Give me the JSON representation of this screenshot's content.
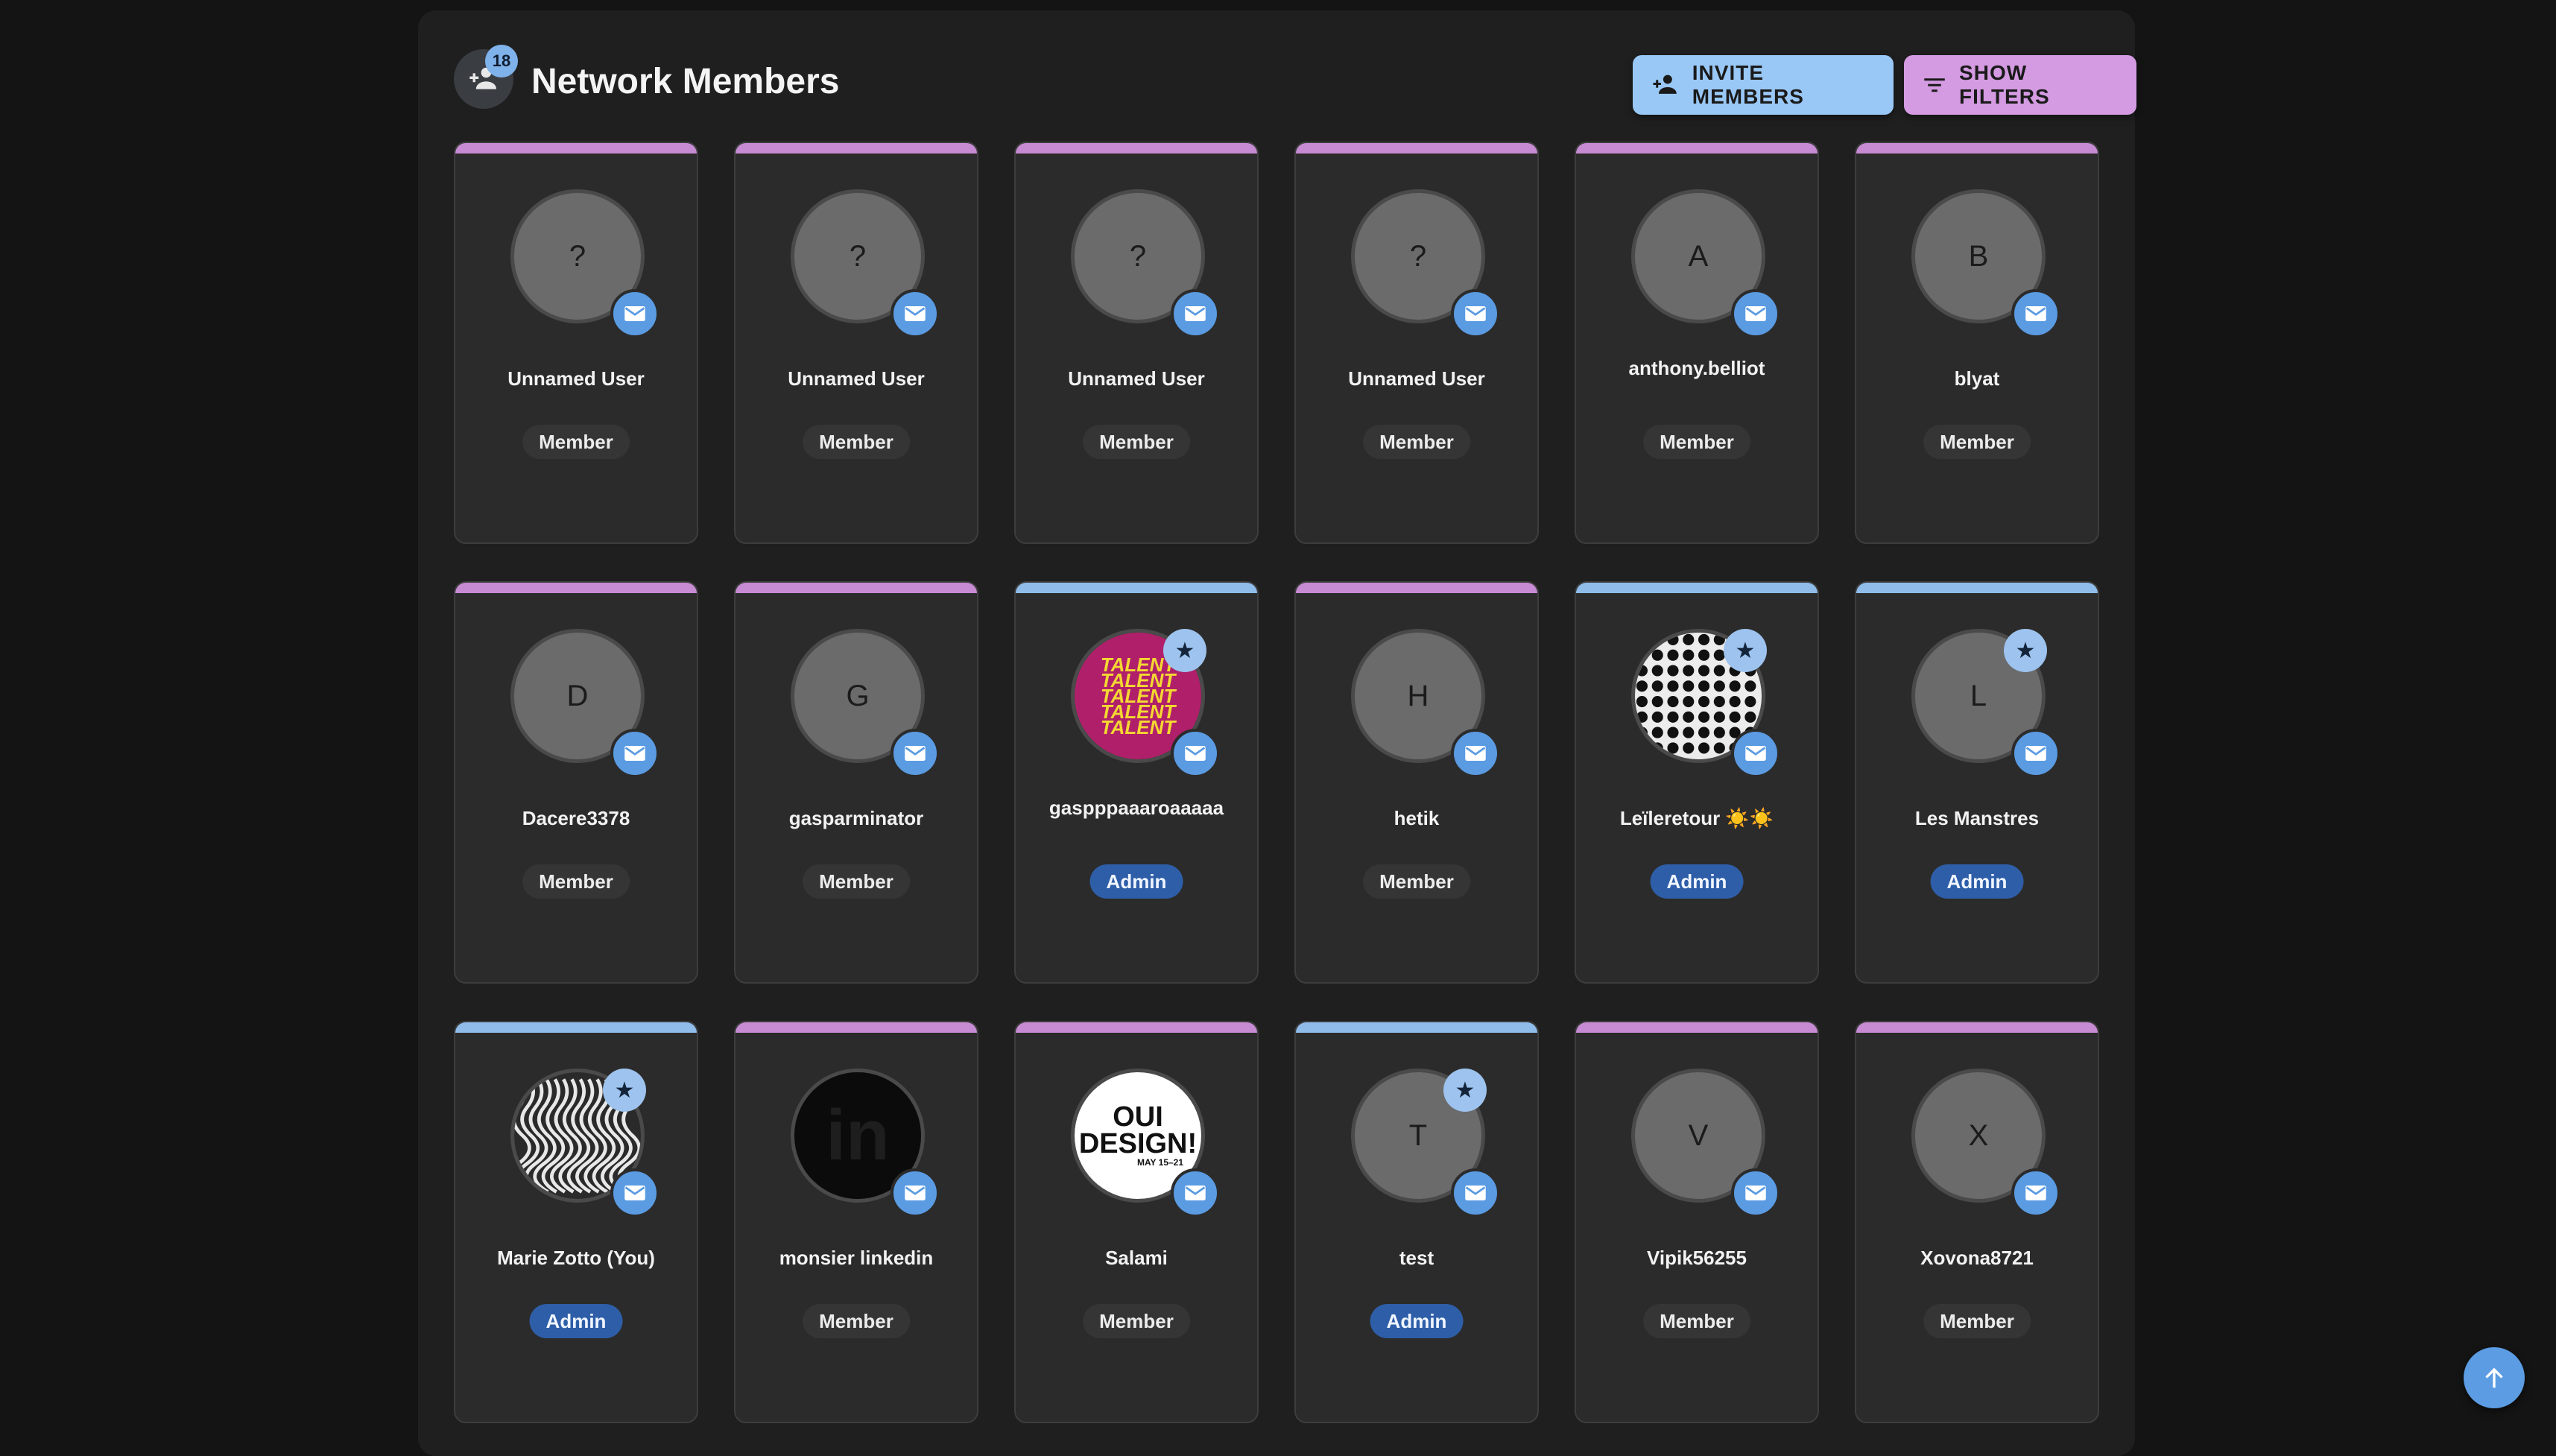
{
  "header": {
    "title": "Network Members",
    "member_count": "18",
    "invite_label": "INVITE MEMBERS",
    "filter_label": "SHOW FILTERS"
  },
  "colors": {
    "member_bar": "#c68bd3",
    "admin_bar": "#8fbce9"
  },
  "members": [
    {
      "name": "Unnamed User",
      "role": "Member",
      "initial": "?",
      "image": null,
      "starred": false
    },
    {
      "name": "Unnamed User",
      "role": "Member",
      "initial": "?",
      "image": null,
      "starred": false
    },
    {
      "name": "Unnamed User",
      "role": "Member",
      "initial": "?",
      "image": null,
      "starred": false
    },
    {
      "name": "Unnamed User",
      "role": "Member",
      "initial": "?",
      "image": null,
      "starred": false
    },
    {
      "name": "anthony.belliot",
      "role": "Member",
      "initial": "A",
      "image": null,
      "starred": false
    },
    {
      "name": "blyat",
      "role": "Member",
      "initial": "B",
      "image": null,
      "starred": false
    },
    {
      "name": "Dacere3378",
      "role": "Member",
      "initial": "D",
      "image": null,
      "starred": false
    },
    {
      "name": "gasparminator",
      "role": "Member",
      "initial": "G",
      "image": null,
      "starred": false
    },
    {
      "name": "gaspppaaaroaaaaa",
      "role": "Admin",
      "initial": "",
      "image": "talent",
      "starred": true
    },
    {
      "name": "hetik",
      "role": "Member",
      "initial": "H",
      "image": null,
      "starred": false
    },
    {
      "name": "Leïleretour ☀️☀️",
      "role": "Admin",
      "initial": "",
      "image": "pattern",
      "starred": true
    },
    {
      "name": "Les Manstres",
      "role": "Admin",
      "initial": "L",
      "image": null,
      "starred": true
    },
    {
      "name": "Marie Zotto (You)",
      "role": "Admin",
      "initial": "",
      "image": "maze",
      "starred": true
    },
    {
      "name": "monsier linkedin",
      "role": "Member",
      "initial": "",
      "image": "linkedin",
      "starred": false
    },
    {
      "name": "Salami",
      "role": "Member",
      "initial": "",
      "image": "ouidesign",
      "starred": false
    },
    {
      "name": "test",
      "role": "Admin",
      "initial": "T",
      "image": null,
      "starred": true
    },
    {
      "name": "Vipik56255",
      "role": "Member",
      "initial": "V",
      "image": null,
      "starred": false
    },
    {
      "name": "Xovona8721",
      "role": "Member",
      "initial": "X",
      "image": null,
      "starred": false
    }
  ],
  "image_text": {
    "talent": "TALENT",
    "oui": "OUI",
    "design": "DESIGN!",
    "dates": "MAY 15–21",
    "linkedin": "in"
  },
  "icons": {
    "mail": "mail-icon",
    "star": "star-icon",
    "invite": "person-add-icon",
    "filter": "filter-icon",
    "scroll_top": "arrow-up-icon"
  }
}
